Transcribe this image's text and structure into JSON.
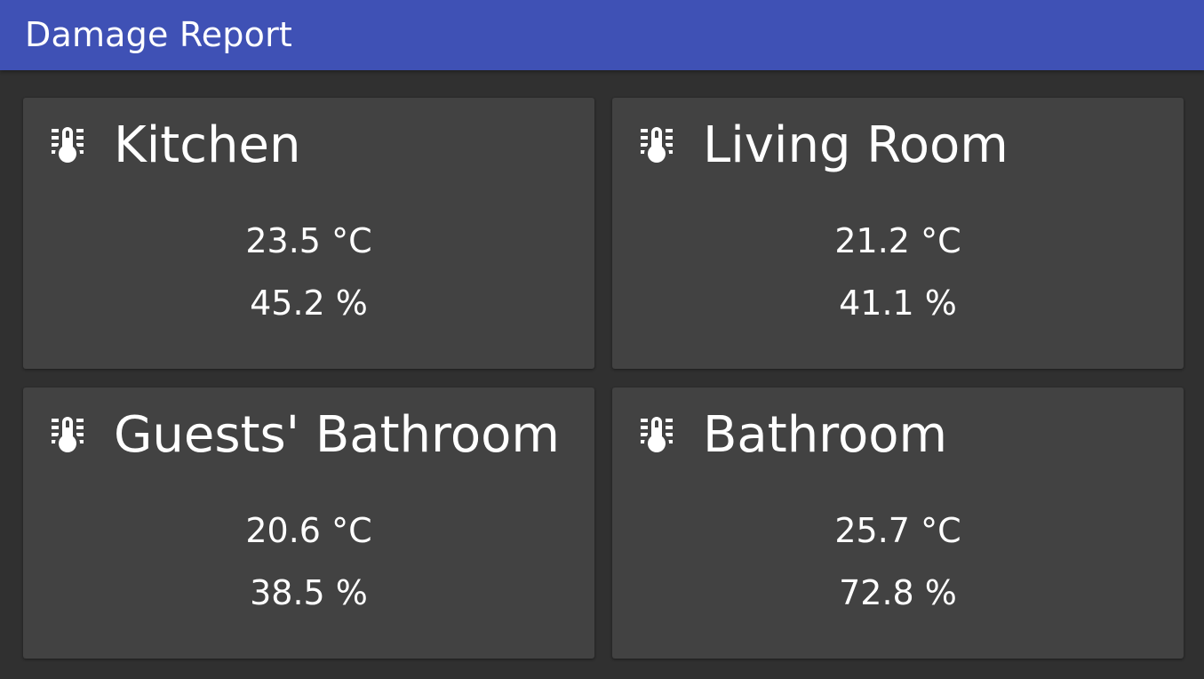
{
  "app_bar": {
    "title": "Damage Report",
    "color": "#3f51b5"
  },
  "cards": [
    {
      "name": "Kitchen",
      "icon": "thermometer-lines-icon",
      "temperature": "23.5 °C",
      "humidity": "45.2 %"
    },
    {
      "name": "Living Room",
      "icon": "thermometer-lines-icon",
      "temperature": "21.2 °C",
      "humidity": "41.1 %"
    },
    {
      "name": "Guests' Bathroom",
      "icon": "thermometer-lines-icon",
      "temperature": "20.6 °C",
      "humidity": "38.5 %"
    },
    {
      "name": "Bathroom",
      "icon": "thermometer-lines-icon",
      "temperature": "25.7 °C",
      "humidity": "72.8 %"
    }
  ],
  "colors": {
    "background": "#303030",
    "card": "#424242",
    "text": "#ffffff"
  }
}
